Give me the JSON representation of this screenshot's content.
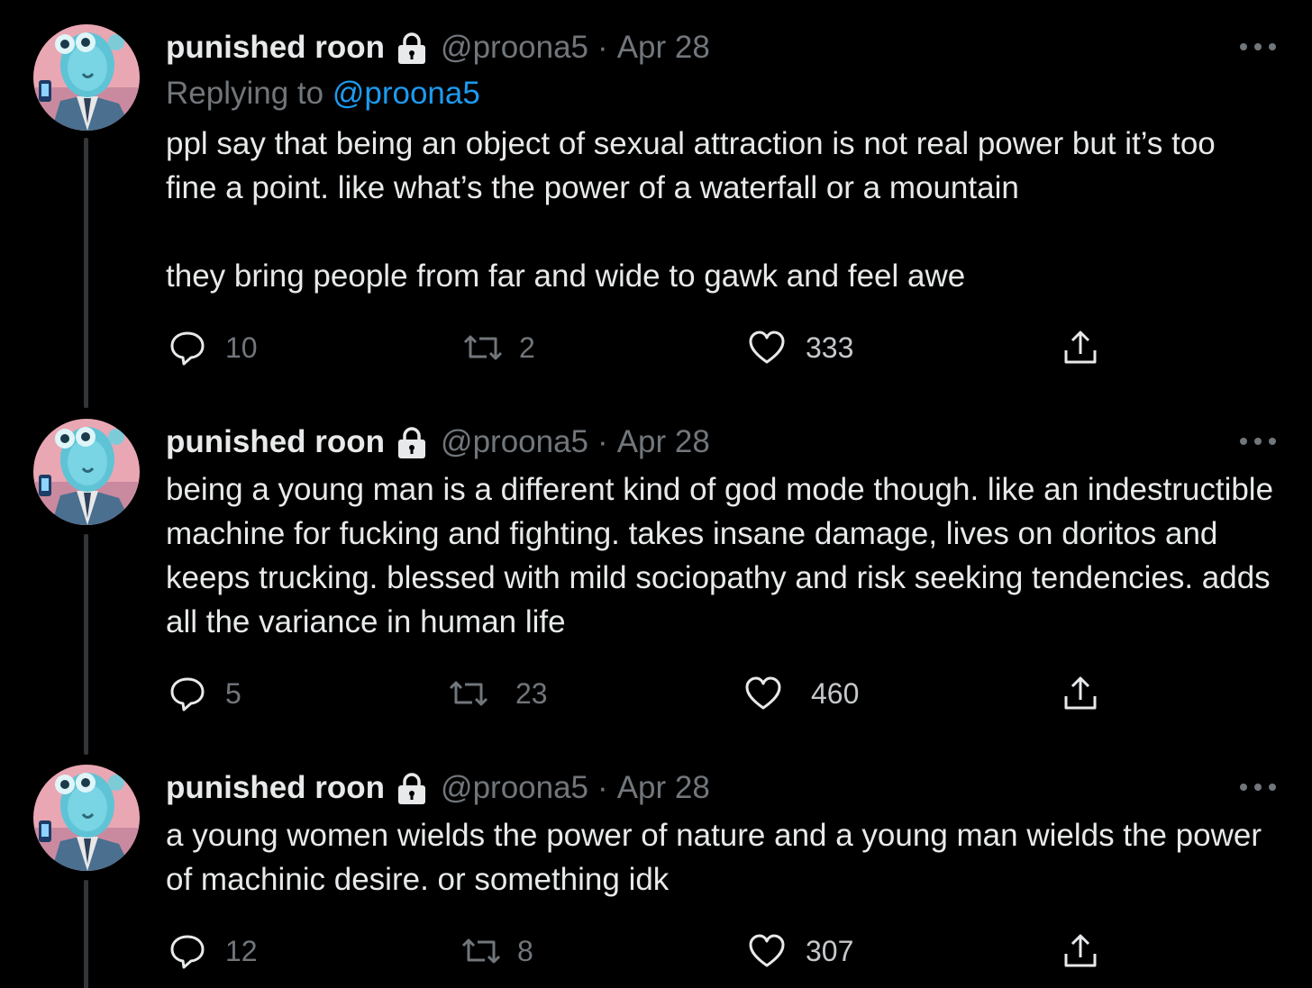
{
  "author": {
    "name": "punished roon",
    "handle": "@proona5",
    "date_separator": "·"
  },
  "tweets": [
    {
      "date": "Apr 28",
      "replying_prefix": "Replying to",
      "replying_handle": "@proona5",
      "paragraphs": [
        "ppl say that being an object of sexual attraction is not real power but it’s too fine a point. like what’s the power of a waterfall or a mountain",
        "they bring people from far and wide to gawk and feel awe"
      ],
      "replies": "10",
      "retweets": "2",
      "likes": "333"
    },
    {
      "date": "Apr 28",
      "paragraphs": [
        "being a young man is a different kind of god mode though. like an indestructible machine for fucking and fighting. takes insane damage, lives on doritos and keeps trucking. blessed with mild sociopathy and risk seeking tendencies. adds all the variance in human life"
      ],
      "replies": "5",
      "retweets": "23",
      "likes": "460"
    },
    {
      "date": "Apr 28",
      "paragraphs": [
        "a young women wields the power of nature and a young man wields the power of machinic desire. or something idk"
      ],
      "replies": "12",
      "retweets": "8",
      "likes": "307"
    }
  ],
  "icons": {
    "lock": "lock-icon",
    "more": "more-icon",
    "reply": "reply-icon",
    "retweet": "retweet-icon",
    "like": "heart-icon",
    "share": "share-icon"
  },
  "colors": {
    "background": "#000000",
    "text": "#e7e9ea",
    "muted": "#71767b",
    "link": "#1d9bf0",
    "thread_line": "#333639"
  }
}
